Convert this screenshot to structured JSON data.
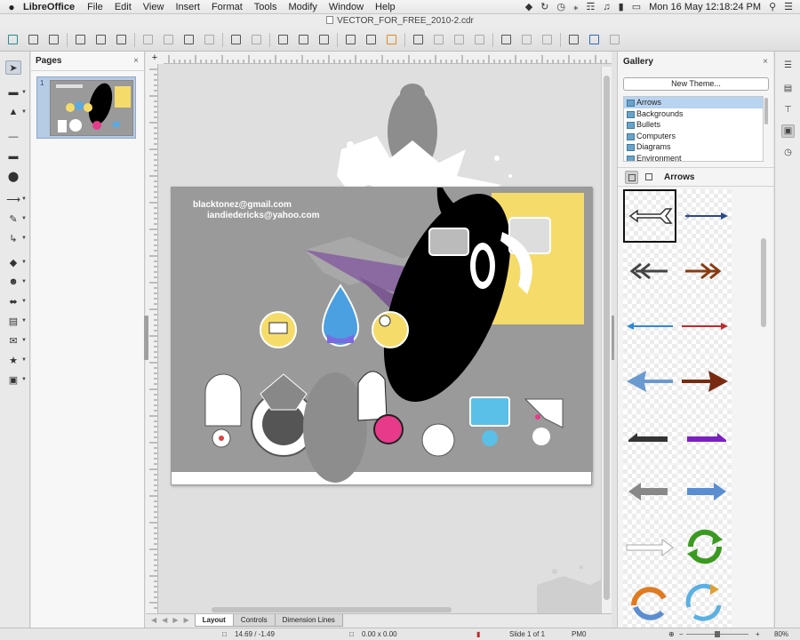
{
  "menubar": {
    "app_name": "LibreOffice",
    "items": [
      "File",
      "Edit",
      "View",
      "Insert",
      "Format",
      "Tools",
      "Modify",
      "Window",
      "Help"
    ],
    "clock": "Mon 16 May  12:18:24 PM"
  },
  "window": {
    "title": "VECTOR_FOR_FREE_2010-2.cdr"
  },
  "pages_panel": {
    "title": "Pages",
    "close": "×",
    "thumb_number": "1"
  },
  "slide": {
    "email_1": "blacktonez@gmail.com",
    "email_2": "iandiedericks@yahoo.com"
  },
  "gallery": {
    "title": "Gallery",
    "close": "×",
    "new_theme_label": "New Theme...",
    "themes": [
      "Arrows",
      "Backgrounds",
      "Bullets",
      "Computers",
      "Diagrams",
      "Environment"
    ],
    "selected_theme": "Arrows",
    "current_label": "Arrows"
  },
  "tabs": [
    "Layout",
    "Controls",
    "Dimension Lines"
  ],
  "status": {
    "position": "14.69 / -1.49",
    "size": "0.00 x 0.00",
    "slide": "Slide 1 of 1",
    "layout": "PM0",
    "zoom": "80%"
  },
  "colors": {
    "selection_blue": "#b8d4f0",
    "arrow_navy": "#2a4a8a",
    "arrow_brown": "#7a2a10",
    "arrow_purple": "#7a20c0",
    "arrow_blue": "#5a8ed0",
    "arrow_green": "#3a9a20",
    "slide_gray": "#9a9a9a"
  }
}
